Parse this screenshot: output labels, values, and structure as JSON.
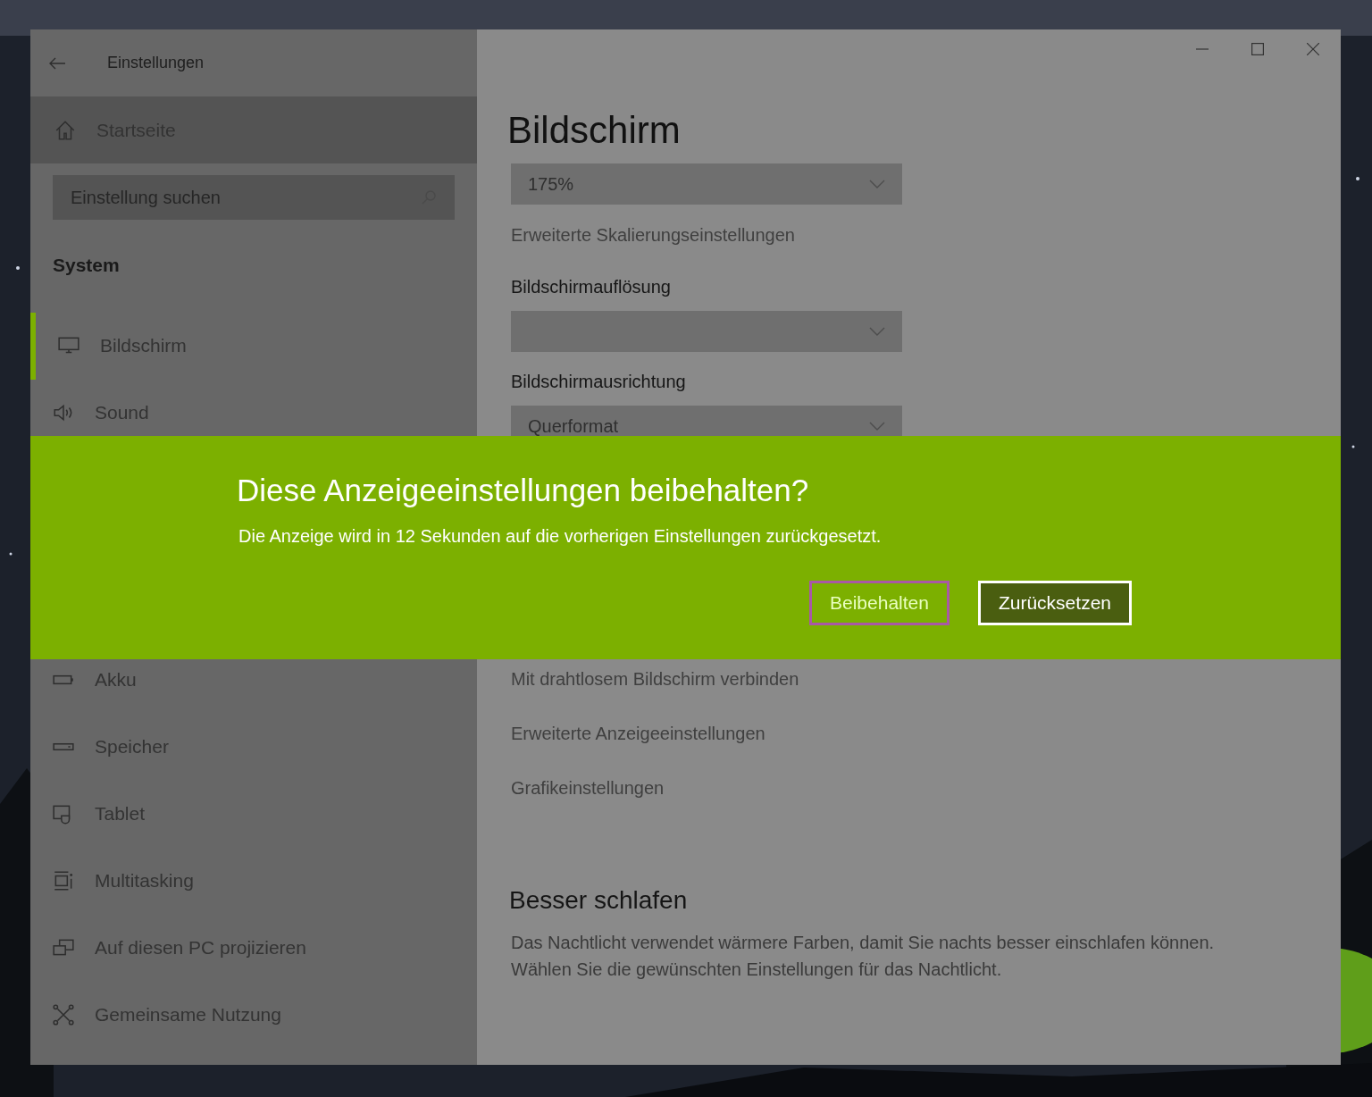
{
  "window": {
    "title": "Einstellungen"
  },
  "sidebar": {
    "home": {
      "label": "Startseite"
    },
    "search": {
      "placeholder": "Einstellung suchen"
    },
    "section": "System",
    "items_above": [
      {
        "label": "Bildschirm",
        "kind": "display",
        "selected": true
      },
      {
        "label": "Sound",
        "kind": "sound",
        "selected": false
      }
    ],
    "items_below": [
      {
        "label": "Akku",
        "kind": "battery",
        "selected": false
      },
      {
        "label": "Speicher",
        "kind": "storage",
        "selected": false
      },
      {
        "label": "Tablet",
        "kind": "tablet",
        "selected": false
      },
      {
        "label": "Multitasking",
        "kind": "multitasking",
        "selected": false
      },
      {
        "label": "Auf diesen PC projizieren",
        "kind": "project",
        "selected": false
      },
      {
        "label": "Gemeinsame Nutzung",
        "kind": "share",
        "selected": false
      }
    ]
  },
  "content": {
    "title": "Bildschirm",
    "scale_dropdown": {
      "value": "175%"
    },
    "scale_link": "Erweiterte Skalierungseinstellungen",
    "resolution_label": "Bildschirmauflösung",
    "orientation_label": "Bildschirmausrichtung",
    "orientation_dropdown": {
      "value": "Querformat"
    },
    "links": [
      "Mit drahtlosem Bildschirm verbinden",
      "Erweiterte Anzeigeeinstellungen",
      "Grafikeinstellungen"
    ],
    "section_title": "Besser schlafen",
    "section_text": [
      "Das Nachtlicht verwendet wärmere Farben, damit Sie nachts besser einschlafen können.",
      "Wählen Sie die gewünschten Einstellungen für das Nachtlicht."
    ]
  },
  "dialog": {
    "title": "Diese Anzeigeeinstellungen beibehalten?",
    "message": "Die Anzeige wird in 12 Sekunden auf die vorherigen Einstellungen zurückgesetzt.",
    "buttons": [
      {
        "label": "Beibehalten",
        "kind": "plain",
        "focused": true
      },
      {
        "label": "Zurücksetzen",
        "kind": "default",
        "focused": false
      }
    ]
  }
}
